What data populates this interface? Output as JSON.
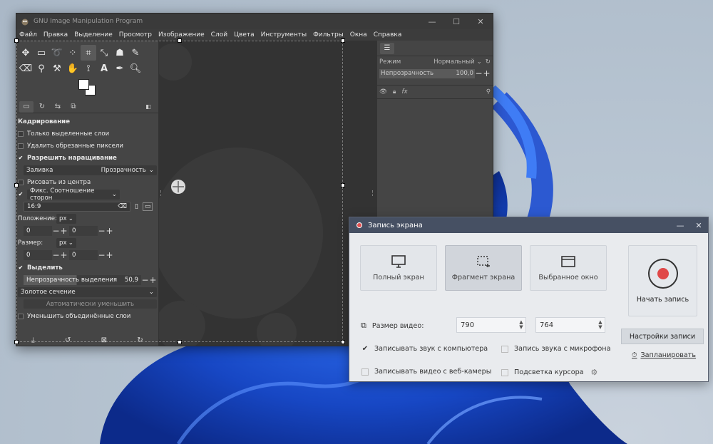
{
  "gimp": {
    "title": "GNU Image Manipulation Program",
    "menu": [
      "Файл",
      "Правка",
      "Выделение",
      "Просмотр",
      "Изображение",
      "Слой",
      "Цвета",
      "Инструменты",
      "Фильтры",
      "Окна",
      "Справка"
    ],
    "tool_options": {
      "section_title": "Кадрирование",
      "only_selected_layer": "Только выделенные слои",
      "delete_cropped_pixels": "Удалить обрезанные пиксели",
      "allow_growing": "Разрешить наращивание",
      "fill_label": "Заливка",
      "fill_value": "Прозрачность",
      "draw_from_center": "Рисовать из центра",
      "fixed_label": "Фикс. Соотношение сторон",
      "ratio_value": "16:9",
      "position_label": "Положение:",
      "position_unit": "px",
      "position_x": "0",
      "position_y": "0",
      "size_label": "Размер:",
      "size_unit": "px",
      "size_w": "0",
      "size_h": "0",
      "highlight_label": "Выделить",
      "highlight_opacity_label": "Непрозрачность выделения",
      "highlight_opacity_value": "50,9",
      "guides_value": "Золотое сечение",
      "auto_shrink": "Автоматически уменьшить",
      "shrink_merged": "Уменьшить объединённые слои"
    },
    "layers": {
      "mode_label": "Режим",
      "mode_value": "Нормальный",
      "opacity_label": "Непрозрачность",
      "opacity_value": "100,0"
    }
  },
  "recorder": {
    "title": "Запись экрана",
    "modes": [
      "Полный экран",
      "Фрагмент экрана",
      "Выбранное окно"
    ],
    "selected_mode": 1,
    "start_label": "Начать запись",
    "video_size_label": "Размер видео:",
    "width": "790",
    "height": "764",
    "record_system_sound": "Записывать звук с компьютера",
    "record_mic": "Запись звука с микрофона",
    "record_webcam": "Записывать видео с веб-камеры",
    "cursor_highlight": "Подсветка курсора",
    "settings_button": "Настройки записи",
    "schedule_link": "Запланировать",
    "accent_color": "#e04848"
  }
}
